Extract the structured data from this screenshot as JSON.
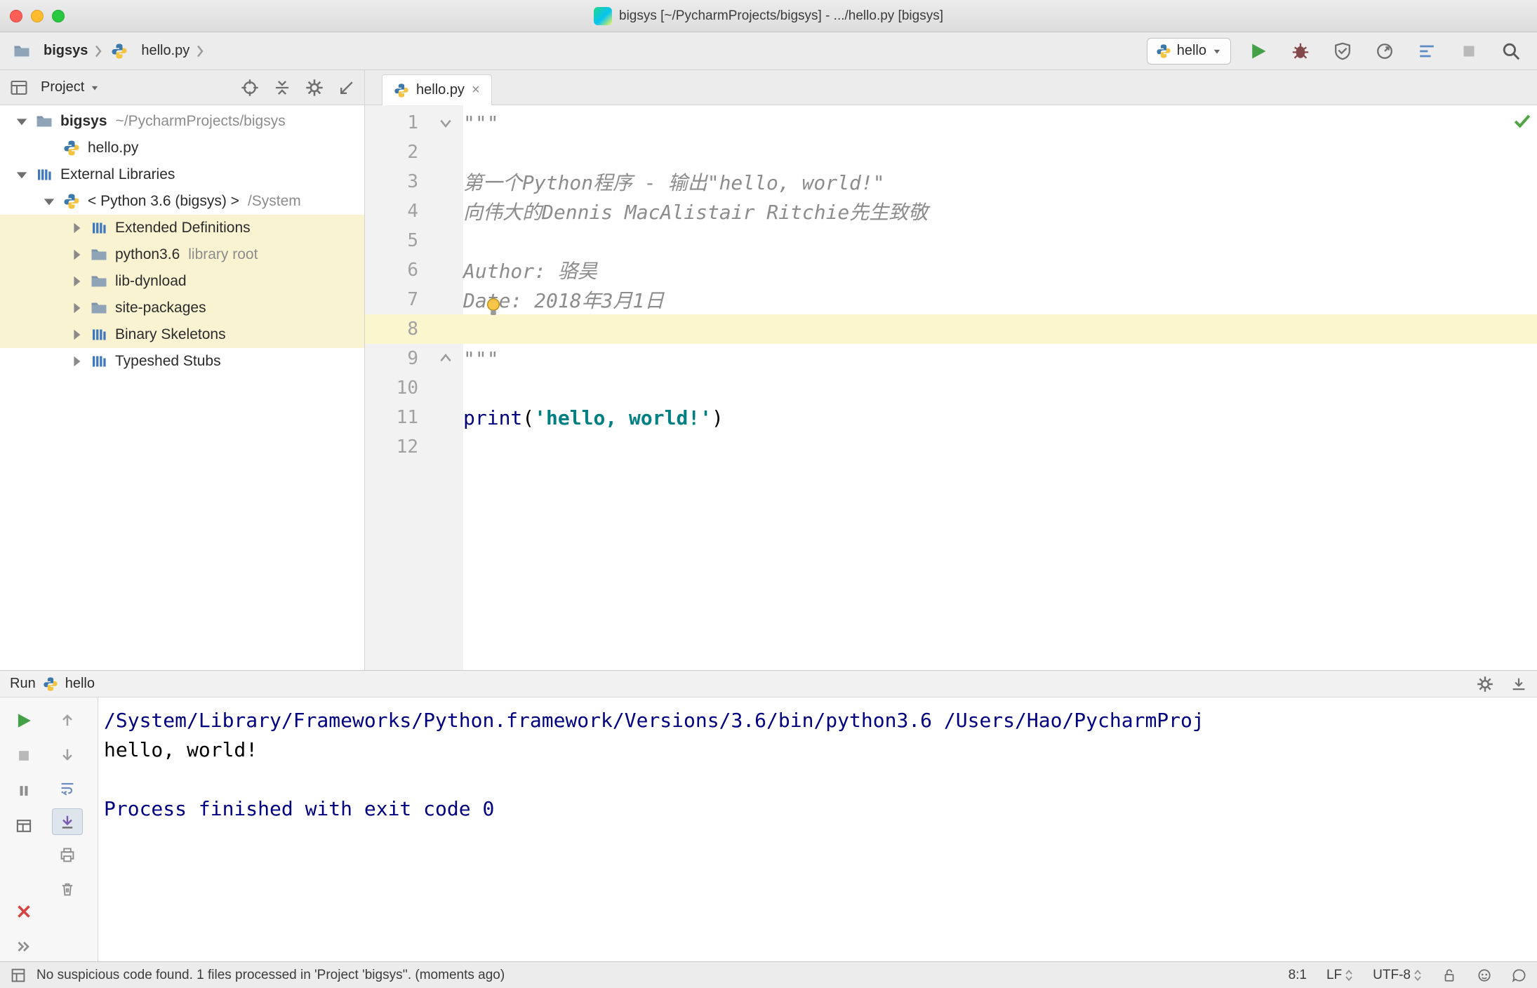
{
  "window": {
    "title": "bigsys [~/PycharmProjects/bigsys] - .../hello.py [bigsys]"
  },
  "navbar": {
    "breadcrumb": {
      "project": "bigsys",
      "file": "hello.py"
    },
    "run_config_label": "hello"
  },
  "project_panel": {
    "title": "Project",
    "tree": [
      {
        "label": "bigsys",
        "suffix": "~/PycharmProjects/bigsys",
        "level": 0,
        "state": "expanded",
        "icon": "folder",
        "bold": true
      },
      {
        "label": "hello.py",
        "suffix": "",
        "level": 1,
        "state": "leaf",
        "icon": "python-file",
        "bold": false
      },
      {
        "label": "External Libraries",
        "suffix": "",
        "level": 0,
        "state": "expanded",
        "icon": "libraries",
        "bold": false
      },
      {
        "label": "< Python 3.6 (bigsys) >",
        "suffix": "/System",
        "level": 1,
        "state": "expanded",
        "icon": "python-file",
        "bold": false
      },
      {
        "label": "Extended Definitions",
        "suffix": "",
        "level": 2,
        "state": "collapsed",
        "icon": "libraries",
        "bold": false,
        "highlight": true
      },
      {
        "label": "python3.6",
        "suffix": "library root",
        "level": 2,
        "state": "collapsed",
        "icon": "folder",
        "bold": false,
        "highlight": true
      },
      {
        "label": "lib-dynload",
        "suffix": "",
        "level": 2,
        "state": "collapsed",
        "icon": "folder",
        "bold": false,
        "highlight": true
      },
      {
        "label": "site-packages",
        "suffix": "",
        "level": 2,
        "state": "collapsed",
        "icon": "folder",
        "bold": false,
        "highlight": true
      },
      {
        "label": "Binary Skeletons",
        "suffix": "",
        "level": 2,
        "state": "collapsed",
        "icon": "libraries",
        "bold": false,
        "highlight": true
      },
      {
        "label": "Typeshed Stubs",
        "suffix": "",
        "level": 2,
        "state": "collapsed",
        "icon": "libraries",
        "bold": false
      }
    ]
  },
  "editor": {
    "tab_label": "hello.py",
    "lines": [
      {
        "num": 1,
        "fold": "start",
        "segments": [
          {
            "text": "\"\"\"",
            "style": "docstring"
          }
        ]
      },
      {
        "num": 2,
        "segments": []
      },
      {
        "num": 3,
        "segments": [
          {
            "text": "第一个Python程序 - 输出\"hello, world!\"",
            "style": "docstring"
          }
        ]
      },
      {
        "num": 4,
        "segments": [
          {
            "text": "向伟大的Dennis MacAlistair Ritchie先生致敬",
            "style": "docstring"
          }
        ]
      },
      {
        "num": 5,
        "segments": []
      },
      {
        "num": 6,
        "segments": [
          {
            "text": "Author: 骆昊",
            "style": "docstring"
          }
        ]
      },
      {
        "num": 7,
        "segments": [
          {
            "text": "Date: 2018年3月1日",
            "style": "docstring"
          }
        ]
      },
      {
        "num": 8,
        "current": true,
        "segments": []
      },
      {
        "num": 9,
        "fold": "end",
        "segments": [
          {
            "text": "\"\"\"",
            "style": "docstring"
          }
        ]
      },
      {
        "num": 10,
        "segments": []
      },
      {
        "num": 11,
        "segments": [
          {
            "text": "print",
            "style": "keyword"
          },
          {
            "text": "(",
            "style": "plain"
          },
          {
            "text": "'hello, world!'",
            "style": "string"
          },
          {
            "text": ")",
            "style": "plain"
          }
        ]
      },
      {
        "num": 12,
        "segments": []
      }
    ]
  },
  "run_panel": {
    "title": "Run",
    "config_label": "hello",
    "console_lines": [
      {
        "text": "/System/Library/Frameworks/Python.framework/Versions/3.6/bin/python3.6 /Users/Hao/PycharmProj",
        "style": "info"
      },
      {
        "text": "hello, world!",
        "style": "stdout"
      },
      {
        "text": "",
        "style": "stdout"
      },
      {
        "text": "Process finished with exit code 0",
        "style": "info"
      }
    ]
  },
  "status_bar": {
    "message": "No suspicious code found. 1 files processed in 'Project 'bigsys''. (moments ago)",
    "caret_position": "8:1",
    "line_separator": "LF",
    "encoding": "UTF-8"
  }
}
